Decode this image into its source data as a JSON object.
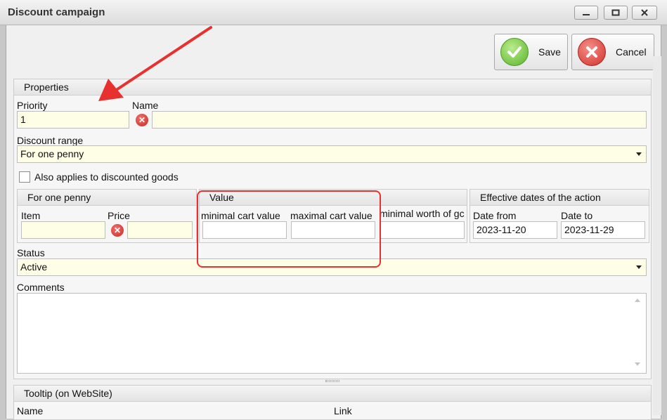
{
  "window": {
    "title": "Discount campaign"
  },
  "toolbar": {
    "save_label": "Save",
    "cancel_label": "Cancel"
  },
  "properties": {
    "header": "Properties",
    "priority_label": "Priority",
    "priority_value": "1",
    "name_label": "Name",
    "name_value": "",
    "discount_range_label": "Discount range",
    "discount_range_value": "For one penny",
    "also_applies_label": "Also applies to discounted goods"
  },
  "penny": {
    "header": "For one penny",
    "item_label": "Item",
    "price_label": "Price"
  },
  "value": {
    "header": "Value",
    "min_label": "minimal cart value",
    "max_label": "maximal cart value",
    "worth_label": "minimal worth of gc"
  },
  "dates": {
    "header": "Effective dates of the action",
    "from_label": "Date from",
    "from_value": "2023-11-20",
    "to_label": "Date to",
    "to_value": "2023-11-29"
  },
  "status": {
    "label": "Status",
    "value": "Active"
  },
  "comments": {
    "label": "Comments"
  },
  "tooltip": {
    "header": "Tooltip (on WebSite)",
    "name_label": "Name",
    "link_label": "Link"
  },
  "colors": {
    "annotation_red": "#e8312f",
    "field_yellow": "#fefee6"
  }
}
